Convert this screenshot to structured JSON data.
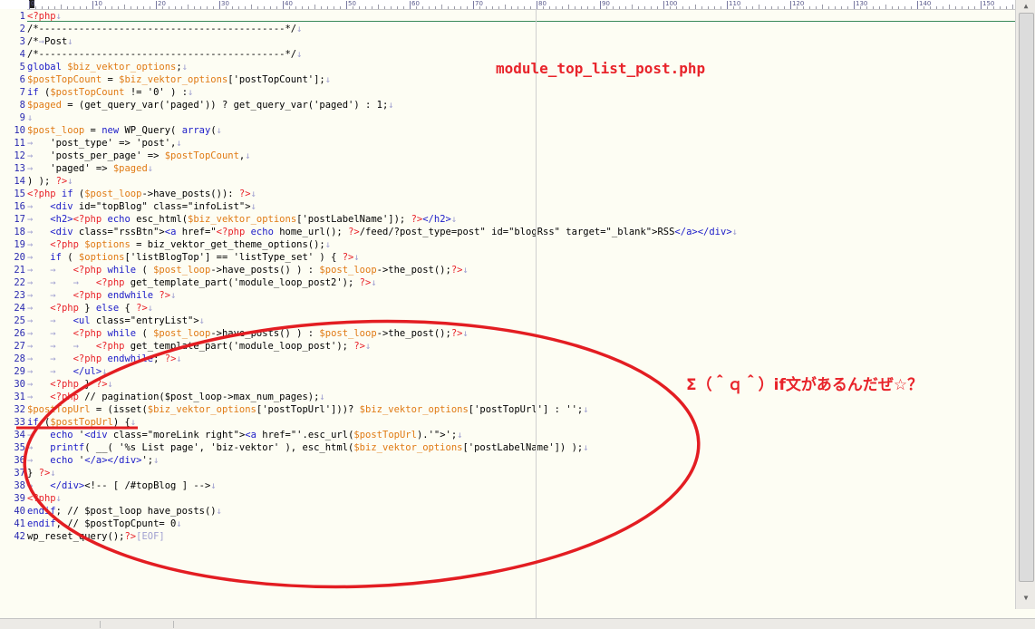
{
  "editor": {
    "ruler_labels": [
      "0",
      "10",
      "20",
      "30",
      "40",
      "50",
      "60",
      "70",
      "80",
      "90",
      "100",
      "110",
      "120",
      "130",
      "140",
      "150"
    ],
    "eof_marker": "[EOF]",
    "colors": {
      "keyword": "#1c1cc8",
      "variable": "#e07a14",
      "php_tag": "#e8232a",
      "string": "#000000",
      "comment": "#000000",
      "line_number": "#2a2ab0",
      "whitespace_mark": "#a0a0d0",
      "annotation": "#e8232a"
    },
    "lines": [
      {
        "n": "1",
        "t": [
          [
            "<?php",
            "r"
          ],
          [
            "↓",
            "w"
          ]
        ]
      },
      {
        "n": "2",
        "t": [
          [
            "/*-------------------------------------------*/",
            "c"
          ],
          [
            "↓",
            "w"
          ]
        ]
      },
      {
        "n": "3",
        "t": [
          [
            "/*",
            "c"
          ],
          [
            "→",
            "w"
          ],
          [
            "Post",
            "c"
          ],
          [
            "↓",
            "w"
          ]
        ]
      },
      {
        "n": "4",
        "t": [
          [
            "/*-------------------------------------------*/",
            "c"
          ],
          [
            "↓",
            "w"
          ]
        ]
      },
      {
        "n": "5",
        "t": [
          [
            "global ",
            "k"
          ],
          [
            "$biz_vektor_options",
            "v"
          ],
          [
            ";",
            "p"
          ],
          [
            "↓",
            "w"
          ]
        ]
      },
      {
        "n": "6",
        "t": [
          [
            "$postTopCount",
            "v"
          ],
          [
            " = ",
            "p"
          ],
          [
            "$biz_vektor_options",
            "v"
          ],
          [
            "['postTopCount'];",
            "p"
          ],
          [
            "↓",
            "w"
          ]
        ]
      },
      {
        "n": "7",
        "t": [
          [
            "if",
            "k"
          ],
          [
            " (",
            "p"
          ],
          [
            "$postTopCount",
            "v"
          ],
          [
            " != '0' ) :",
            "p"
          ],
          [
            "↓",
            "w"
          ]
        ]
      },
      {
        "n": "8",
        "t": [
          [
            "$paged",
            "v"
          ],
          [
            " = (get_query_var('paged')) ? get_query_var('paged') : 1;",
            "p"
          ],
          [
            "↓",
            "w"
          ]
        ]
      },
      {
        "n": "9",
        "t": [
          [
            "↓",
            "w"
          ]
        ]
      },
      {
        "n": "10",
        "t": [
          [
            "$post_loop",
            "v"
          ],
          [
            " = ",
            "p"
          ],
          [
            "new",
            "k"
          ],
          [
            " WP_Query( ",
            "p"
          ],
          [
            "array",
            "k"
          ],
          [
            "(",
            "p"
          ],
          [
            "↓",
            "w"
          ]
        ]
      },
      {
        "n": "11",
        "t": [
          [
            "→   ",
            "w"
          ],
          [
            "'post_type' => 'post',",
            "p"
          ],
          [
            "↓",
            "w"
          ]
        ]
      },
      {
        "n": "12",
        "t": [
          [
            "→   ",
            "w"
          ],
          [
            "'posts_per_page' => ",
            "p"
          ],
          [
            "$postTopCount",
            "v"
          ],
          [
            ",",
            "p"
          ],
          [
            "↓",
            "w"
          ]
        ]
      },
      {
        "n": "13",
        "t": [
          [
            "→   ",
            "w"
          ],
          [
            "'paged' => ",
            "p"
          ],
          [
            "$paged",
            "v"
          ],
          [
            "↓",
            "w"
          ]
        ]
      },
      {
        "n": "14",
        "t": [
          [
            ") ); ",
            "p"
          ],
          [
            "?>",
            "r"
          ],
          [
            "↓",
            "w"
          ]
        ]
      },
      {
        "n": "15",
        "t": [
          [
            "<?php",
            "r"
          ],
          [
            " if",
            "k"
          ],
          [
            " (",
            "p"
          ],
          [
            "$post_loop",
            "v"
          ],
          [
            "->have_posts()): ",
            "p"
          ],
          [
            "?>",
            "r"
          ],
          [
            "↓",
            "w"
          ]
        ]
      },
      {
        "n": "16",
        "t": [
          [
            "→   ",
            "w"
          ],
          [
            "<div",
            "k"
          ],
          [
            " id=\"topBlog\" class=\"infoList\">",
            "p"
          ],
          [
            "↓",
            "w"
          ]
        ]
      },
      {
        "n": "17",
        "t": [
          [
            "→   ",
            "w"
          ],
          [
            "<h2>",
            "k"
          ],
          [
            "<?php",
            "r"
          ],
          [
            " echo",
            "k"
          ],
          [
            " esc_html(",
            "p"
          ],
          [
            "$biz_vektor_options",
            "v"
          ],
          [
            "['postLabelName']); ",
            "p"
          ],
          [
            "?>",
            "r"
          ],
          [
            "</h2>",
            "k"
          ],
          [
            "↓",
            "w"
          ]
        ]
      },
      {
        "n": "18",
        "t": [
          [
            "→   ",
            "w"
          ],
          [
            "<div",
            "k"
          ],
          [
            " class=\"rssBtn\">",
            "p"
          ],
          [
            "<a",
            "k"
          ],
          [
            " href=\"",
            "p"
          ],
          [
            "<?php",
            "r"
          ],
          [
            " echo",
            "k"
          ],
          [
            " home_url(); ",
            "p"
          ],
          [
            "?>",
            "r"
          ],
          [
            "/feed/?post_type=post\" id=\"blogRss\" target=\"_blank\">RSS",
            "p"
          ],
          [
            "</a></div>",
            "k"
          ],
          [
            "↓",
            "w"
          ]
        ]
      },
      {
        "n": "19",
        "t": [
          [
            "→   ",
            "w"
          ],
          [
            "<?php",
            "r"
          ],
          [
            " $options",
            "v"
          ],
          [
            " = biz_vektor_get_theme_options();",
            "p"
          ],
          [
            "↓",
            "w"
          ]
        ]
      },
      {
        "n": "20",
        "t": [
          [
            "→   ",
            "w"
          ],
          [
            "if",
            "k"
          ],
          [
            " ( ",
            "p"
          ],
          [
            "$options",
            "v"
          ],
          [
            "['listBlogTop'] == 'listType_set' ) { ",
            "p"
          ],
          [
            "?>",
            "r"
          ],
          [
            "↓",
            "w"
          ]
        ]
      },
      {
        "n": "21",
        "t": [
          [
            "→   →   ",
            "w"
          ],
          [
            "<?php",
            "r"
          ],
          [
            " while",
            "k"
          ],
          [
            " ( ",
            "p"
          ],
          [
            "$post_loop",
            "v"
          ],
          [
            "->have_posts() ) : ",
            "p"
          ],
          [
            "$post_loop",
            "v"
          ],
          [
            "->the_post();",
            "p"
          ],
          [
            "?>",
            "r"
          ],
          [
            "↓",
            "w"
          ]
        ]
      },
      {
        "n": "22",
        "t": [
          [
            "→   →   →   ",
            "w"
          ],
          [
            "<?php",
            "r"
          ],
          [
            " get_template_part('module_loop_post2'); ",
            "p"
          ],
          [
            "?>",
            "r"
          ],
          [
            "↓",
            "w"
          ]
        ]
      },
      {
        "n": "23",
        "t": [
          [
            "→   →   ",
            "w"
          ],
          [
            "<?php",
            "r"
          ],
          [
            " endwhile",
            "k"
          ],
          [
            " ",
            "p"
          ],
          [
            "?>",
            "r"
          ],
          [
            "↓",
            "w"
          ]
        ]
      },
      {
        "n": "24",
        "t": [
          [
            "→   ",
            "w"
          ],
          [
            "<?php",
            "r"
          ],
          [
            " } ",
            "p"
          ],
          [
            "else",
            "k"
          ],
          [
            " { ",
            "p"
          ],
          [
            "?>",
            "r"
          ],
          [
            "↓",
            "w"
          ]
        ]
      },
      {
        "n": "25",
        "t": [
          [
            "→   →   ",
            "w"
          ],
          [
            "<ul",
            "k"
          ],
          [
            " class=\"entryList\">",
            "p"
          ],
          [
            "↓",
            "w"
          ]
        ]
      },
      {
        "n": "26",
        "t": [
          [
            "→   →   ",
            "w"
          ],
          [
            "<?php",
            "r"
          ],
          [
            " while",
            "k"
          ],
          [
            " ( ",
            "p"
          ],
          [
            "$post_loop",
            "v"
          ],
          [
            "->have_posts() ) : ",
            "p"
          ],
          [
            "$post_loop",
            "v"
          ],
          [
            "->the_post();",
            "p"
          ],
          [
            "?>",
            "r"
          ],
          [
            "↓",
            "w"
          ]
        ]
      },
      {
        "n": "27",
        "t": [
          [
            "→   →   →   ",
            "w"
          ],
          [
            "<?php",
            "r"
          ],
          [
            " get_template_part('module_loop_post'); ",
            "p"
          ],
          [
            "?>",
            "r"
          ],
          [
            "↓",
            "w"
          ]
        ]
      },
      {
        "n": "28",
        "t": [
          [
            "→   →   ",
            "w"
          ],
          [
            "<?php",
            "r"
          ],
          [
            " endwhile",
            "k"
          ],
          [
            "; ",
            "p"
          ],
          [
            "?>",
            "r"
          ],
          [
            "↓",
            "w"
          ]
        ]
      },
      {
        "n": "29",
        "t": [
          [
            "→   →   ",
            "w"
          ],
          [
            "</ul>",
            "k"
          ],
          [
            "↓",
            "w"
          ]
        ]
      },
      {
        "n": "30",
        "t": [
          [
            "→   ",
            "w"
          ],
          [
            "<?php",
            "r"
          ],
          [
            " } ",
            "p"
          ],
          [
            "?>",
            "r"
          ],
          [
            "↓",
            "w"
          ]
        ]
      },
      {
        "n": "31",
        "t": [
          [
            "→   ",
            "w"
          ],
          [
            "<?php",
            "r"
          ],
          [
            " // pagination($post_loop->max_num_pages);",
            "c"
          ],
          [
            "↓",
            "w"
          ]
        ]
      },
      {
        "n": "32",
        "t": [
          [
            "$postTopUrl",
            "v"
          ],
          [
            " = (isset(",
            "p"
          ],
          [
            "$biz_vektor_options",
            "v"
          ],
          [
            "['postTopUrl']))? ",
            "p"
          ],
          [
            "$biz_vektor_options",
            "v"
          ],
          [
            "['postTopUrl'] : '';",
            "p"
          ],
          [
            "↓",
            "w"
          ]
        ]
      },
      {
        "n": "33",
        "t": [
          [
            "if",
            "k"
          ],
          [
            " (",
            "p"
          ],
          [
            "$postTopUrl",
            "v"
          ],
          [
            ") {",
            "p"
          ],
          [
            "↓",
            "w"
          ]
        ]
      },
      {
        "n": "34",
        "t": [
          [
            "→   ",
            "w"
          ],
          [
            "echo",
            "k"
          ],
          [
            " '",
            "p"
          ],
          [
            "<div",
            "k"
          ],
          [
            " class=\"moreLink right\">",
            "p"
          ],
          [
            "<a",
            "k"
          ],
          [
            " href=\"'.esc_url(",
            "p"
          ],
          [
            "$postTopUrl",
            "v"
          ],
          [
            ").'\">';",
            "p"
          ],
          [
            "↓",
            "w"
          ]
        ]
      },
      {
        "n": "35",
        "t": [
          [
            "→   ",
            "w"
          ],
          [
            "printf",
            "k"
          ],
          [
            "( __( '%s List page', 'biz-vektor' ), esc_html(",
            "p"
          ],
          [
            "$biz_vektor_options",
            "v"
          ],
          [
            "['postLabelName']) );",
            "p"
          ],
          [
            "↓",
            "w"
          ]
        ]
      },
      {
        "n": "36",
        "t": [
          [
            "→   ",
            "w"
          ],
          [
            "echo",
            "k"
          ],
          [
            " '",
            "p"
          ],
          [
            "</a></div>",
            "k"
          ],
          [
            "';",
            "p"
          ],
          [
            "↓",
            "w"
          ]
        ]
      },
      {
        "n": "37",
        "t": [
          [
            "} ",
            "p"
          ],
          [
            "?>",
            "r"
          ],
          [
            "↓",
            "w"
          ]
        ]
      },
      {
        "n": "38",
        "t": [
          [
            "→   ",
            "w"
          ],
          [
            "</div>",
            "k"
          ],
          [
            "<!-- [ /#topBlog ] -->",
            "c"
          ],
          [
            "↓",
            "w"
          ]
        ]
      },
      {
        "n": "39",
        "t": [
          [
            "<?php",
            "r"
          ],
          [
            "↓",
            "w"
          ]
        ]
      },
      {
        "n": "40",
        "t": [
          [
            "endif",
            "k"
          ],
          [
            "; // $post_loop have_posts()",
            "c"
          ],
          [
            "↓",
            "w"
          ]
        ]
      },
      {
        "n": "41",
        "t": [
          [
            "endif",
            "k"
          ],
          [
            "; // $postTopCpunt= 0",
            "c"
          ],
          [
            "↓",
            "w"
          ]
        ]
      },
      {
        "n": "42",
        "t": [
          [
            "wp_reset_query();",
            "p"
          ],
          [
            "?>",
            "r"
          ],
          [
            "[EOF]",
            "e"
          ]
        ]
      }
    ]
  },
  "annotations": {
    "file_title": "module_top_list_post.php",
    "comment": "Σ（＾ｑ＾）if文があるんだぜ☆？"
  }
}
